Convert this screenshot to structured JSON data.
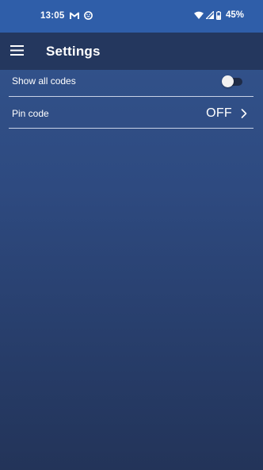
{
  "status_bar": {
    "time": "13:05",
    "battery_percent": "45%",
    "icons": [
      "gmail-icon",
      "smiley-notification-icon",
      "wifi-icon",
      "cellular-signal-icon",
      "battery-icon"
    ]
  },
  "app_bar": {
    "title": "Settings",
    "menu_icon": "hamburger-menu-icon"
  },
  "settings": {
    "show_all_codes": {
      "label": "Show all codes",
      "enabled": false
    },
    "pin_code": {
      "label": "Pin code",
      "value": "OFF",
      "icon": "chevron-right-icon"
    }
  },
  "colors": {
    "status_bar": "#2f5ea9",
    "app_bar": "#24375e",
    "background_top": "#33558f",
    "background_bottom": "#233459",
    "divider": "#c8d2e6"
  }
}
